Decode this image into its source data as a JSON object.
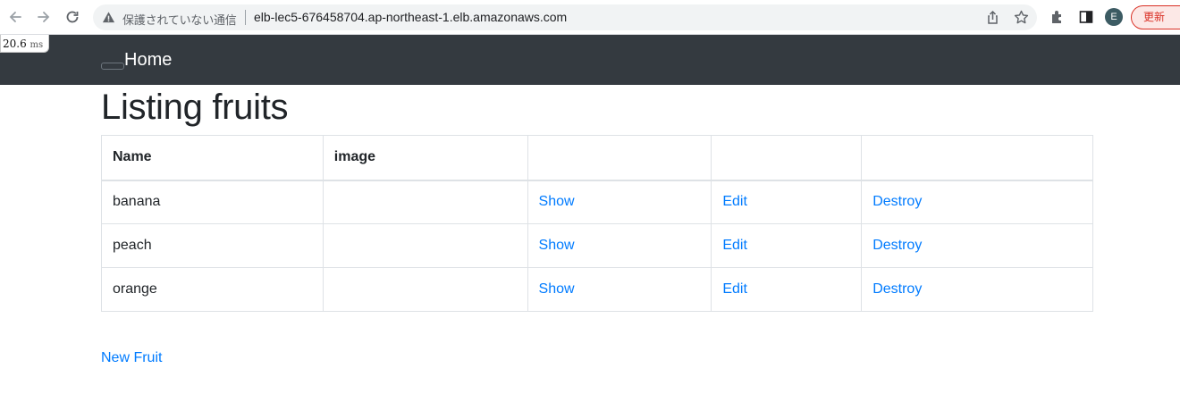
{
  "browser": {
    "security_label": "保護されていない通信",
    "url": "elb-lec5-676458704.ap-northeast-1.elb.amazonaws.com",
    "profile_initial": "E",
    "update_label": "更新"
  },
  "timing": {
    "value": "20.6",
    "unit": "ms"
  },
  "navbar": {
    "brand": "Home"
  },
  "page": {
    "title": "Listing fruits"
  },
  "table": {
    "headers": [
      "Name",
      "image",
      "",
      "",
      ""
    ],
    "rows": [
      {
        "name": "banana",
        "image": "",
        "show": "Show",
        "edit": "Edit",
        "destroy": "Destroy"
      },
      {
        "name": "peach",
        "image": "",
        "show": "Show",
        "edit": "Edit",
        "destroy": "Destroy"
      },
      {
        "name": "orange",
        "image": "",
        "show": "Show",
        "edit": "Edit",
        "destroy": "Destroy"
      }
    ]
  },
  "actions": {
    "new_label": "New Fruit"
  },
  "colors": {
    "navbar_bg": "#343a40",
    "link": "#007bff",
    "border": "#dee2e6"
  }
}
